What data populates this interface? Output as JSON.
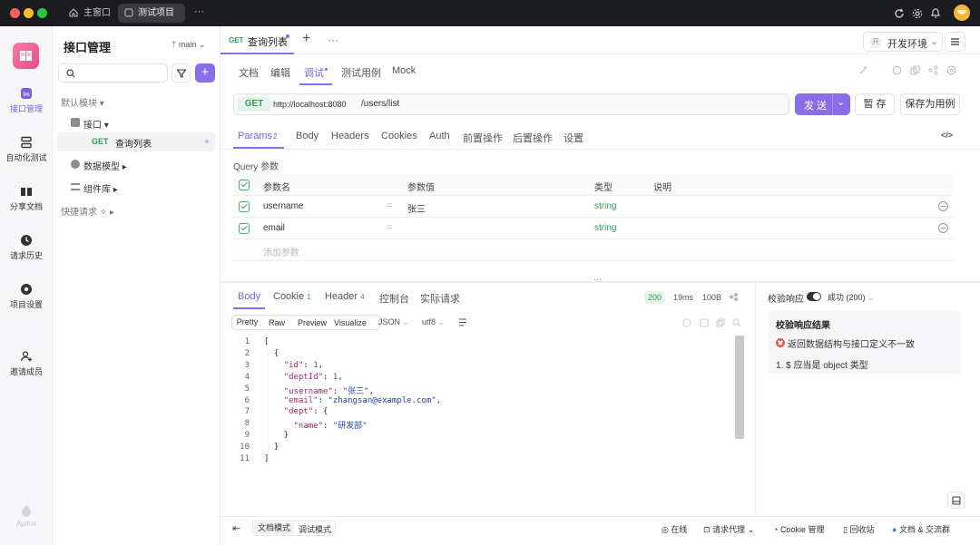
{
  "titlebar": {
    "home_tab": "主窗口",
    "active_tab": "测试项目",
    "more": "···"
  },
  "rail": {
    "items": [
      {
        "label": "接口管理",
        "icon": "api-icon"
      },
      {
        "label": "自动化测试",
        "icon": "automation-icon"
      },
      {
        "label": "分享文档",
        "icon": "book-icon"
      },
      {
        "label": "请求历史",
        "icon": "clock-icon"
      },
      {
        "label": "项目设置",
        "icon": "settings-icon"
      },
      {
        "label": "邀请成员",
        "icon": "add-user-icon"
      }
    ],
    "brand": "Apifox"
  },
  "tree": {
    "title": "接口管理",
    "branch": "main",
    "default_module": "默认模块 ▾",
    "api_folder": "接口 ▾",
    "endpoint_method": "GET",
    "endpoint_name": "查询列表",
    "data_models": "数据模型 ▸",
    "components": "组件库 ▸",
    "quick_requests": "快捷请求 ✧ ▸"
  },
  "doc_tab": {
    "method": "GET",
    "title": "查询列表",
    "env": "开发环境",
    "env_badge": "开"
  },
  "subtabs": [
    "文档",
    "编辑",
    "调试",
    "测试用例",
    "Mock"
  ],
  "request": {
    "method": "GET",
    "base": "http://localhost:8080",
    "path": "/users/list",
    "send": "发 送",
    "save_tmp": "暂 存",
    "save_case": "保存为用例"
  },
  "param_tabs": {
    "params": "Params",
    "params_count": "2",
    "others": [
      "Body",
      "Headers",
      "Cookies",
      "Auth",
      "前置操作",
      "后置操作",
      "设置"
    ],
    "code_icon": "</>"
  },
  "query": {
    "title": "Query 参数",
    "headers": [
      "参数名",
      "参数值",
      "类型",
      "说明"
    ],
    "rows": [
      {
        "name": "username",
        "value": "张三",
        "type": "string"
      },
      {
        "name": "email",
        "value": "",
        "type": "string"
      }
    ],
    "add_placeholder": "添加参数"
  },
  "response": {
    "tabs": {
      "body": "Body",
      "cookie": "Cookie",
      "cookie_count": "1",
      "header": "Header",
      "header_count": "4",
      "console": "控制台",
      "actual": "实际请求"
    },
    "status": "200",
    "time": "19ms",
    "size": "100B",
    "view_modes": [
      "Pretty",
      "Raw",
      "Preview",
      "Visualize"
    ],
    "format": "JSON",
    "encoding": "utf8",
    "code_lines": [
      {
        "n": "1",
        "t": "["
      },
      {
        "n": "2",
        "t": "  {"
      },
      {
        "n": "3",
        "key": "\"id\"",
        "val": "1",
        "kind": "num",
        "indent": "    "
      },
      {
        "n": "4",
        "key": "\"deptId\"",
        "val": "1",
        "kind": "num",
        "indent": "    "
      },
      {
        "n": "5",
        "key": "\"username\"",
        "val": "\"张三\"",
        "kind": "str",
        "indent": "    "
      },
      {
        "n": "6",
        "key": "\"email\"",
        "val": "\"zhangsan@example.com\"",
        "kind": "str",
        "indent": "    "
      },
      {
        "n": "7",
        "key": "\"dept\"",
        "val": "{",
        "kind": "plain",
        "indent": "    ",
        "nocomma": true
      },
      {
        "n": "8",
        "key": "\"name\"",
        "val": "\"研发部\"",
        "kind": "str",
        "indent": "      ",
        "nocomma": true
      },
      {
        "n": "9",
        "t": "    }"
      },
      {
        "n": "10",
        "t": "  }"
      },
      {
        "n": "11",
        "t": "]"
      }
    ]
  },
  "validation": {
    "label": "校验响应",
    "status_select": "成功 (200)",
    "title": "校验响应结果",
    "error": "返回数据结构与接口定义不一致",
    "detail": "1. $ 应当是 object 类型"
  },
  "footer": {
    "doc_mode": "文档模式",
    "debug_mode": "调试模式",
    "online": "在线",
    "proxy": "请求代理",
    "cookie": "Cookie 管理",
    "trash": "回收站",
    "community": "文档 & 交流群"
  },
  "colors": {
    "accent": "#8a6de9",
    "get": "#2f9d5b",
    "error": "#e0534a"
  }
}
